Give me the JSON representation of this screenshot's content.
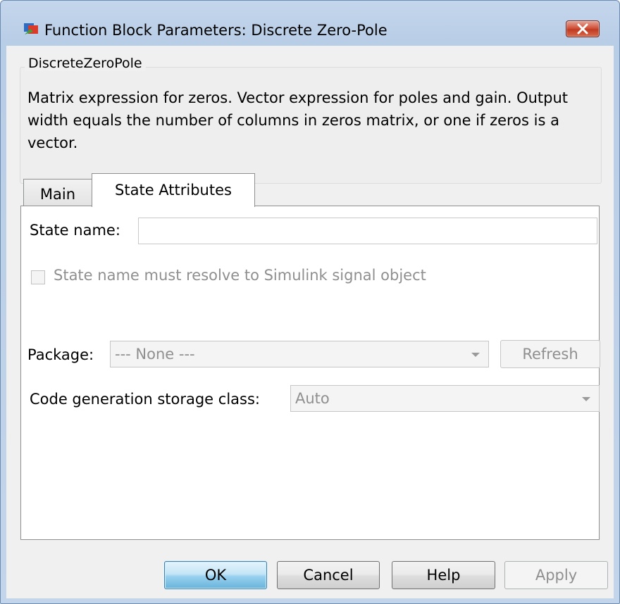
{
  "window": {
    "title": "Function Block Parameters: Discrete Zero-Pole",
    "close_label": "✕"
  },
  "group": {
    "title": "DiscreteZeroPole",
    "description": "Matrix expression for zeros.  Vector expression for poles and gain. Output width equals the number of columns in zeros matrix, or one if zeros is a vector."
  },
  "tabs": [
    {
      "label": "Main",
      "selected": false
    },
    {
      "label": "State Attributes",
      "selected": true
    }
  ],
  "form": {
    "state_name_label": "State name:",
    "state_name_value": "",
    "resolve_checkbox_label": "State name must resolve to Simulink signal object",
    "resolve_checked": false,
    "package_label": "Package:",
    "package_value": "--- None ---",
    "refresh_label": "Refresh",
    "storage_class_label": "Code generation storage class:",
    "storage_class_value": "Auto"
  },
  "buttons": {
    "ok": "OK",
    "cancel": "Cancel",
    "help": "Help",
    "apply": "Apply"
  },
  "colors": {
    "title_bar": "#b8cde6",
    "close_button": "#c03a22",
    "disabled_text": "#8f8f8f"
  }
}
